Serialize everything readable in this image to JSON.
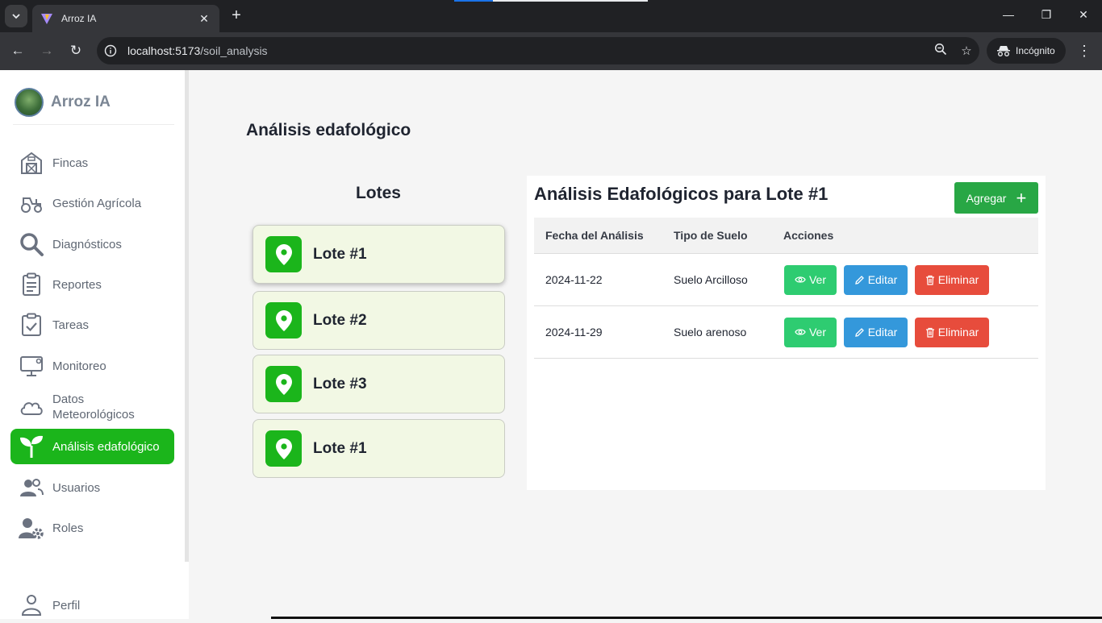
{
  "browser": {
    "tab_title": "Arroz IA",
    "url_host": "localhost:5173",
    "url_path": "/soil_analysis",
    "incognito_label": "Incógnito"
  },
  "sidebar": {
    "brand": "Arroz IA",
    "items": [
      {
        "label": "Fincas",
        "icon": "barn-icon"
      },
      {
        "label": "Gestión Agrícola",
        "icon": "tractor-icon"
      },
      {
        "label": "Diagnósticos",
        "icon": "search-icon"
      },
      {
        "label": "Reportes",
        "icon": "clipboard-icon"
      },
      {
        "label": "Tareas",
        "icon": "task-check-icon"
      },
      {
        "label": "Monitoreo",
        "icon": "monitor-icon"
      },
      {
        "label": "Datos Meteorológicos",
        "icon": "cloud-icon"
      },
      {
        "label": "Análisis edafológico",
        "icon": "sprout-icon",
        "active": true
      },
      {
        "label": "Usuarios",
        "icon": "users-icon"
      },
      {
        "label": "Roles",
        "icon": "user-gear-icon"
      },
      {
        "label": "Perfil",
        "icon": "user-icon"
      }
    ]
  },
  "page": {
    "title": "Análisis edafológico"
  },
  "lotes": {
    "title": "Lotes",
    "items": [
      "Lote #1",
      "Lote #2",
      "Lote #3",
      "Lote #1"
    ],
    "selected_index": 0
  },
  "analysis": {
    "title": "Análisis Edafológicos para Lote #1",
    "add_label": "Agregar",
    "headers": [
      "Fecha del Análisis",
      "Tipo de Suelo",
      "Acciones"
    ],
    "rows": [
      {
        "date": "2024-11-22",
        "soil": "Suelo Arcilloso"
      },
      {
        "date": "2024-11-29",
        "soil": "Suelo arenoso"
      }
    ],
    "actions": {
      "view": "Ver",
      "edit": "Editar",
      "delete": "Eliminar"
    }
  },
  "colors": {
    "brand_green": "#1bb51b",
    "add_button": "#28a745",
    "view_button": "#2ecc71",
    "edit_button": "#3498db",
    "delete_button": "#e74c3c",
    "lote_card_bg": "#f2f8e4"
  }
}
